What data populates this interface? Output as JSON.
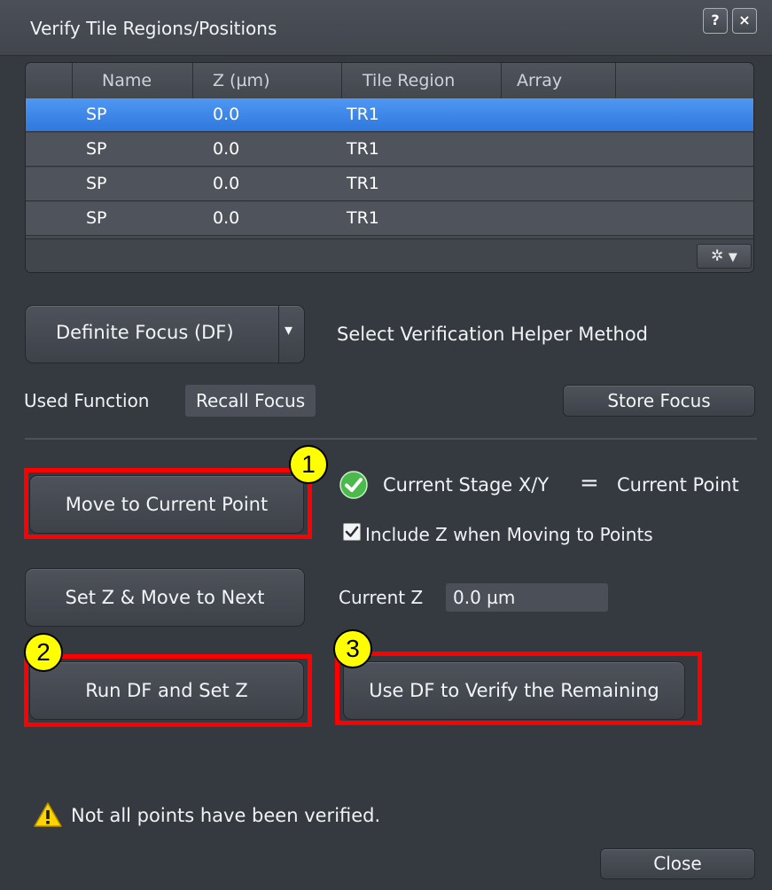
{
  "window": {
    "title": "Verify Tile Regions/Positions",
    "help_label": "?",
    "close_label": "×"
  },
  "table": {
    "columns": [
      "Name",
      "Z (µm)",
      "Tile Region",
      "Array"
    ],
    "rows": [
      {
        "name": "SP",
        "z": "0.0",
        "tile_region": "TR1",
        "array": "",
        "selected": true
      },
      {
        "name": "SP",
        "z": "0.0",
        "tile_region": "TR1",
        "array": "",
        "selected": false
      },
      {
        "name": "SP",
        "z": "0.0",
        "tile_region": "TR1",
        "array": "",
        "selected": false
      },
      {
        "name": "SP",
        "z": "0.0",
        "tile_region": "TR1",
        "array": "",
        "selected": false
      }
    ],
    "settings_icon": "gear-icon"
  },
  "method": {
    "dropdown_value": "Definite Focus (DF)",
    "dropdown_arrow": "▾",
    "caption": "Select Verification Helper Method"
  },
  "function": {
    "label": "Used Function",
    "value": "Recall Focus",
    "store_button": "Store Focus"
  },
  "actions": {
    "move_current": "Move to Current Point",
    "stage_status_left": "Current Stage X/Y",
    "stage_status_eq": "=",
    "stage_status_right": "Current Point",
    "include_z_label": "Include Z when Moving to Points",
    "include_z_checked": true,
    "set_z_next": "Set Z & Move to Next",
    "current_z_label": "Current Z",
    "current_z_value": "0.0 µm",
    "run_df": "Run DF and Set Z",
    "use_df": "Use DF to Verify the Remaining"
  },
  "annotations": {
    "badge1": "1",
    "badge2": "2",
    "badge3": "3",
    "highlight_color": "#ff0000",
    "badge_color": "#ffff00"
  },
  "status": {
    "warning_icon": "warning-icon",
    "message": "Not all points have been verified."
  },
  "footer": {
    "close_button": "Close"
  }
}
